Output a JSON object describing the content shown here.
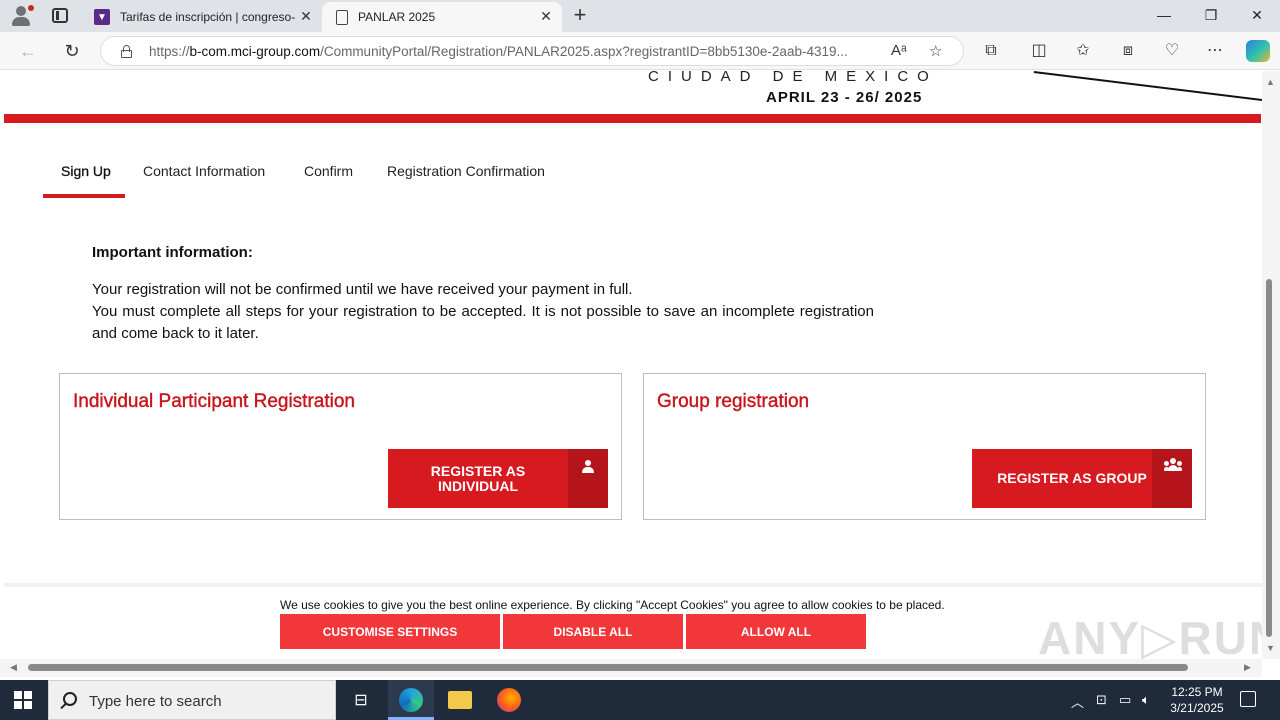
{
  "browser": {
    "tabs": [
      {
        "title": "Tarifas de inscripción | congreso-",
        "active": false
      },
      {
        "title": "PANLAR 2025",
        "active": true
      }
    ],
    "url_prefix": "https://",
    "url_domain": "b-com.mci-group.com",
    "url_path": "/CommunityPortal/Registration/PANLAR2025.aspx?registrantID=8bb5130e-2aab-4319...",
    "new_tab": "+",
    "close_glyph": "✕",
    "minimize": "—",
    "restore": "❐",
    "close_window": "✕"
  },
  "header": {
    "city": "CIUDAD DE MEXICO",
    "dates": "APRIL 23 - 26/ 2025"
  },
  "steps": [
    {
      "label": "Sign Up",
      "active": true
    },
    {
      "label": "Contact Information",
      "active": false
    },
    {
      "label": "Confirm",
      "active": false
    },
    {
      "label": "Registration Confirmation",
      "active": false
    }
  ],
  "info": {
    "title": "Important information:",
    "line1": "Your registration will not be confirmed until we have received your payment in full.",
    "line2": "You must complete all steps for your registration to be accepted. It is not possible to save an incomplete registration and come back to it later."
  },
  "cards": {
    "individual": {
      "title": "Individual Participant Registration",
      "button": "REGISTER AS INDIVIDUAL"
    },
    "group": {
      "title": "Group registration",
      "button": "REGISTER AS GROUP"
    }
  },
  "cookie": {
    "text": "We use cookies to give you the best online experience. By clicking \"Accept Cookies\" you agree to allow cookies to be placed.",
    "customise": "CUSTOMISE SETTINGS",
    "disable": "DISABLE ALL",
    "allow": "ALLOW ALL"
  },
  "watermark": "ANY▷RUN",
  "taskbar": {
    "search_placeholder": "Type here to search",
    "time": "12:25 PM",
    "date": "3/21/2025"
  },
  "colors": {
    "brand_red": "#d71920",
    "cookie_red": "#f2373b",
    "title_red": "#c8151c"
  }
}
